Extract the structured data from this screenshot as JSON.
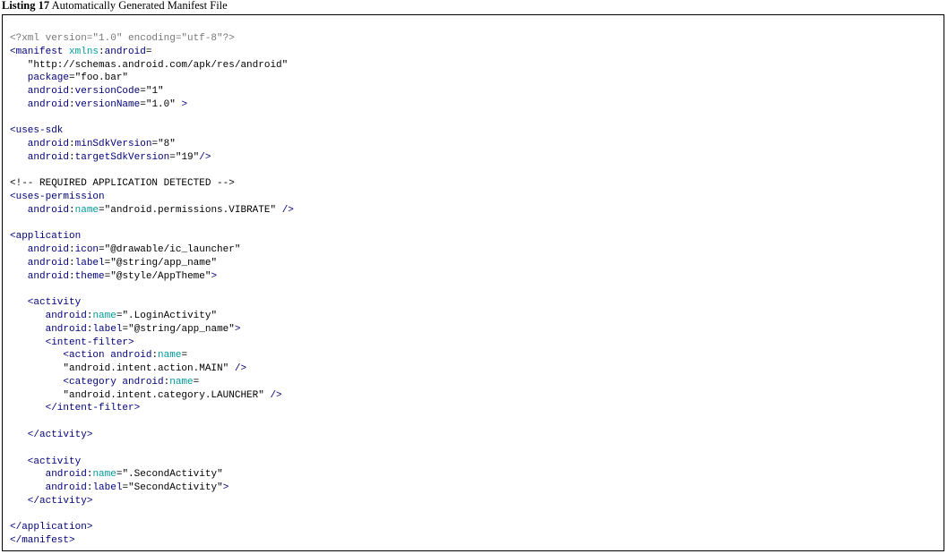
{
  "caption": {
    "label": "Listing 17",
    "title": "Automatically Generated Manifest File"
  },
  "code": [
    [
      [
        "pi",
        "<?xml version=\"1.0\" encoding=\"utf-8\"?>"
      ]
    ],
    [
      [
        "t",
        "<manifest "
      ],
      [
        "ns",
        "xmlns"
      ],
      [
        "p",
        ":"
      ],
      [
        "a",
        "android"
      ],
      [
        "p",
        "="
      ]
    ],
    [
      [
        "v",
        "   \"http://schemas.android.com/apk/res/android\""
      ]
    ],
    [
      [
        "a",
        "   package"
      ],
      [
        "p",
        "="
      ],
      [
        "v",
        "\"foo.bar\""
      ]
    ],
    [
      [
        "a",
        "   android"
      ],
      [
        "p",
        ":"
      ],
      [
        "a",
        "versionCode"
      ],
      [
        "p",
        "="
      ],
      [
        "v",
        "\"1\""
      ]
    ],
    [
      [
        "a",
        "   android"
      ],
      [
        "p",
        ":"
      ],
      [
        "a",
        "versionName"
      ],
      [
        "p",
        "="
      ],
      [
        "v",
        "\"1.0\" "
      ],
      [
        "t",
        ">"
      ]
    ],
    [],
    [
      [
        "t",
        "<uses-sdk"
      ]
    ],
    [
      [
        "a",
        "   android"
      ],
      [
        "p",
        ":"
      ],
      [
        "a",
        "minSdkVersion"
      ],
      [
        "p",
        "="
      ],
      [
        "v",
        "\"8\""
      ]
    ],
    [
      [
        "a",
        "   android"
      ],
      [
        "p",
        ":"
      ],
      [
        "a",
        "targetSdkVersion"
      ],
      [
        "p",
        "="
      ],
      [
        "v",
        "\"19\""
      ],
      [
        "t",
        "/>"
      ]
    ],
    [],
    [
      [
        "c",
        "<!-- REQUIRED APPLICATION DETECTED -->"
      ]
    ],
    [
      [
        "t",
        "<uses-permission"
      ]
    ],
    [
      [
        "a",
        "   android"
      ],
      [
        "p",
        ":"
      ],
      [
        "ns",
        "name"
      ],
      [
        "p",
        "="
      ],
      [
        "v",
        "\"android.permissions.VIBRATE\" "
      ],
      [
        "t",
        "/>"
      ]
    ],
    [],
    [
      [
        "t",
        "<application"
      ]
    ],
    [
      [
        "a",
        "   android"
      ],
      [
        "p",
        ":"
      ],
      [
        "a",
        "icon"
      ],
      [
        "p",
        "="
      ],
      [
        "v",
        "\"@drawable/ic_launcher\""
      ]
    ],
    [
      [
        "a",
        "   android"
      ],
      [
        "p",
        ":"
      ],
      [
        "a",
        "label"
      ],
      [
        "p",
        "="
      ],
      [
        "v",
        "\"@string/app_name\""
      ]
    ],
    [
      [
        "a",
        "   android"
      ],
      [
        "p",
        ":"
      ],
      [
        "a",
        "theme"
      ],
      [
        "p",
        "="
      ],
      [
        "v",
        "\"@style/AppTheme\""
      ],
      [
        "t",
        ">"
      ]
    ],
    [],
    [
      [
        "t",
        "   <activity"
      ]
    ],
    [
      [
        "a",
        "      android"
      ],
      [
        "p",
        ":"
      ],
      [
        "ns",
        "name"
      ],
      [
        "p",
        "="
      ],
      [
        "v",
        "\".LoginActivity\""
      ]
    ],
    [
      [
        "a",
        "      android"
      ],
      [
        "p",
        ":"
      ],
      [
        "a",
        "label"
      ],
      [
        "p",
        "="
      ],
      [
        "v",
        "\"@string/app_name\""
      ],
      [
        "t",
        ">"
      ]
    ],
    [
      [
        "t",
        "      <intent-filter>"
      ]
    ],
    [
      [
        "t",
        "         <action "
      ],
      [
        "a",
        "android"
      ],
      [
        "p",
        ":"
      ],
      [
        "ns",
        "name"
      ],
      [
        "p",
        "="
      ]
    ],
    [
      [
        "v",
        "         \"android.intent.action.MAIN\" "
      ],
      [
        "t",
        "/>"
      ]
    ],
    [
      [
        "t",
        "         <category "
      ],
      [
        "a",
        "android"
      ],
      [
        "p",
        ":"
      ],
      [
        "ns",
        "name"
      ],
      [
        "p",
        "="
      ]
    ],
    [
      [
        "v",
        "         \"android.intent.category.LAUNCHER\" "
      ],
      [
        "t",
        "/>"
      ]
    ],
    [
      [
        "t",
        "      </intent-filter>"
      ]
    ],
    [],
    [
      [
        "t",
        "   </activity>"
      ]
    ],
    [],
    [
      [
        "t",
        "   <activity"
      ]
    ],
    [
      [
        "a",
        "      android"
      ],
      [
        "p",
        ":"
      ],
      [
        "ns",
        "name"
      ],
      [
        "p",
        "="
      ],
      [
        "v",
        "\".SecondActivity\""
      ]
    ],
    [
      [
        "a",
        "      android"
      ],
      [
        "p",
        ":"
      ],
      [
        "a",
        "label"
      ],
      [
        "p",
        "="
      ],
      [
        "v",
        "\"SecondActivity\""
      ],
      [
        "t",
        ">"
      ]
    ],
    [
      [
        "t",
        "   </activity>"
      ]
    ],
    [],
    [
      [
        "t",
        "</application>"
      ]
    ],
    [
      [
        "t",
        "</manifest>"
      ]
    ]
  ]
}
